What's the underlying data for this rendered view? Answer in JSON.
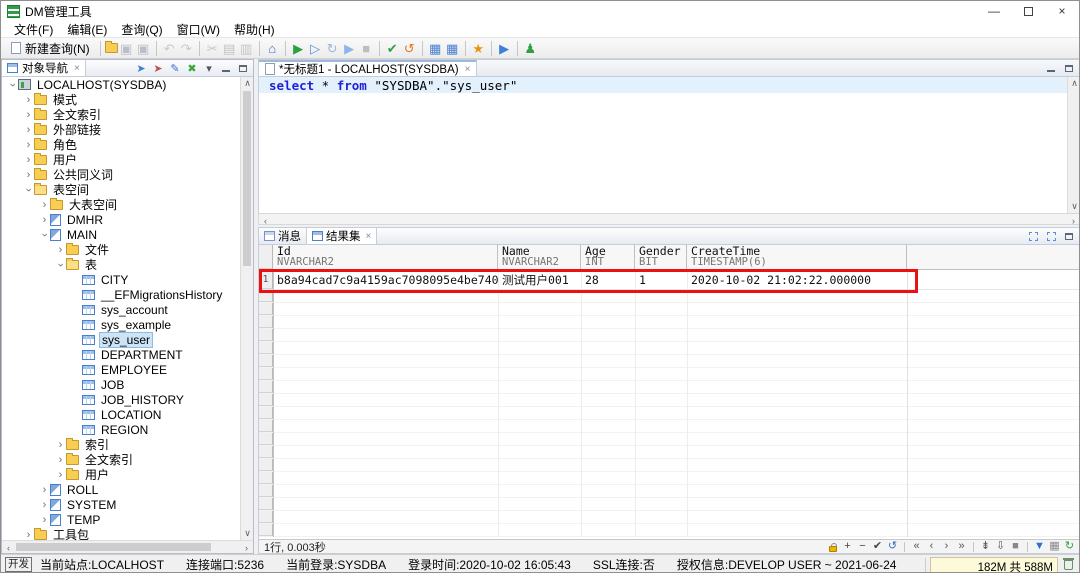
{
  "window": {
    "title": "DM管理工具",
    "controls": {
      "minimize": "—",
      "close": "×"
    }
  },
  "menu": {
    "items": [
      "文件(F)",
      "编辑(E)",
      "查询(Q)",
      "窗口(W)",
      "帮助(H)"
    ]
  },
  "toolbar": {
    "new_query_label": "新建查询(N)",
    "groups": [
      [
        {
          "name": "open-file-icon",
          "art": "folder"
        },
        {
          "name": "save-icon",
          "glyph": "▣",
          "color": "#b8bfc8"
        },
        {
          "name": "save-all-icon",
          "glyph": "▣",
          "color": "#b8bfc8"
        }
      ],
      [
        {
          "name": "undo-icon",
          "glyph": "↶",
          "color": "#c9c9c9"
        },
        {
          "name": "redo-icon",
          "glyph": "↷",
          "color": "#c9c9c9"
        }
      ],
      [
        {
          "name": "cut-icon",
          "glyph": "✂",
          "color": "#c4c4c4"
        },
        {
          "name": "copy-icon",
          "glyph": "▤",
          "color": "#c4c4c4"
        },
        {
          "name": "paste-icon",
          "glyph": "▥",
          "color": "#c4c4c4"
        }
      ],
      [
        {
          "name": "home-icon",
          "glyph": "⌂",
          "color": "#3a6fc4"
        }
      ],
      [
        {
          "name": "run-icon",
          "glyph": "▶",
          "color": "#2ca03c"
        },
        {
          "name": "run-selection-icon",
          "glyph": "▷",
          "color": "#5b8ed8"
        },
        {
          "name": "rerun-icon",
          "glyph": "↻",
          "color": "#9fb6cf"
        },
        {
          "name": "run-script-icon",
          "glyph": "▶",
          "color": "#8fb4e8"
        },
        {
          "name": "stop-icon",
          "glyph": "■",
          "color": "#bdbdbd"
        }
      ],
      [
        {
          "name": "commit-icon",
          "glyph": "✔",
          "color": "#2f9e44"
        },
        {
          "name": "rollback-icon",
          "glyph": "↺",
          "color": "#e07a1f"
        }
      ],
      [
        {
          "name": "explain-plan-icon",
          "glyph": "▦",
          "color": "#4a7fd0"
        },
        {
          "name": "statistics-icon",
          "glyph": "▦",
          "color": "#4a7fd0"
        }
      ],
      [
        {
          "name": "sql-assistant-icon",
          "glyph": "★",
          "color": "#e8950f"
        }
      ],
      [
        {
          "name": "step-run-icon",
          "glyph": "▶",
          "color": "#3f7fd6"
        }
      ],
      [
        {
          "name": "agent-icon",
          "glyph": "♟",
          "color": "#2f9e44"
        }
      ]
    ]
  },
  "navigator": {
    "title": "对象导航",
    "header_icons": [
      {
        "name": "connect-icon",
        "glyph": "➤",
        "color": "#3b7fd0"
      },
      {
        "name": "disconnect-icon",
        "glyph": "➤",
        "color": "#c05050"
      },
      {
        "name": "edit-icon",
        "glyph": "✎",
        "color": "#3a6fc4"
      },
      {
        "name": "close-all-icon",
        "glyph": "✖",
        "color": "#3aa53a"
      },
      {
        "name": "view-menu-icon",
        "glyph": "▾",
        "color": "#556"
      },
      {
        "name": "minimize-icon",
        "art": "min"
      },
      {
        "name": "maximize-icon",
        "art": "max"
      }
    ],
    "tree": [
      {
        "label": "LOCALHOST(SYSDBA)",
        "level": 0,
        "state": "expanded",
        "icon": "server"
      },
      {
        "label": "模式",
        "level": 1,
        "state": "collapsed",
        "icon": "folder"
      },
      {
        "label": "全文索引",
        "level": 1,
        "state": "collapsed",
        "icon": "folder"
      },
      {
        "label": "外部链接",
        "level": 1,
        "state": "collapsed",
        "icon": "folder"
      },
      {
        "label": "角色",
        "level": 1,
        "state": "collapsed",
        "icon": "folder"
      },
      {
        "label": "用户",
        "level": 1,
        "state": "collapsed",
        "icon": "folder"
      },
      {
        "label": "公共同义词",
        "level": 1,
        "state": "collapsed",
        "icon": "folder"
      },
      {
        "label": "表空间",
        "level": 1,
        "state": "expanded",
        "icon": "folder-open"
      },
      {
        "label": "大表空间",
        "level": 2,
        "state": "collapsed",
        "icon": "folder"
      },
      {
        "label": "DMHR",
        "level": 2,
        "state": "collapsed",
        "icon": "ts"
      },
      {
        "label": "MAIN",
        "level": 2,
        "state": "expanded",
        "icon": "ts"
      },
      {
        "label": "文件",
        "level": 3,
        "state": "collapsed",
        "icon": "folder"
      },
      {
        "label": "表",
        "level": 3,
        "state": "expanded",
        "icon": "folder-open"
      },
      {
        "label": "CITY",
        "level": 4,
        "state": "leaf",
        "icon": "table"
      },
      {
        "label": "__EFMigrationsHistory",
        "level": 4,
        "state": "leaf",
        "icon": "table"
      },
      {
        "label": "sys_account",
        "level": 4,
        "state": "leaf",
        "icon": "table"
      },
      {
        "label": "sys_example",
        "level": 4,
        "state": "leaf",
        "icon": "table"
      },
      {
        "label": "sys_user",
        "level": 4,
        "state": "leaf",
        "icon": "table",
        "selected": true
      },
      {
        "label": "DEPARTMENT",
        "level": 4,
        "state": "leaf",
        "icon": "table"
      },
      {
        "label": "EMPLOYEE",
        "level": 4,
        "state": "leaf",
        "icon": "table"
      },
      {
        "label": "JOB",
        "level": 4,
        "state": "leaf",
        "icon": "table"
      },
      {
        "label": "JOB_HISTORY",
        "level": 4,
        "state": "leaf",
        "icon": "table"
      },
      {
        "label": "LOCATION",
        "level": 4,
        "state": "leaf",
        "icon": "table"
      },
      {
        "label": "REGION",
        "level": 4,
        "state": "leaf",
        "icon": "table"
      },
      {
        "label": "索引",
        "level": 3,
        "state": "collapsed",
        "icon": "folder"
      },
      {
        "label": "全文索引",
        "level": 3,
        "state": "collapsed",
        "icon": "folder"
      },
      {
        "label": "用户",
        "level": 3,
        "state": "collapsed",
        "icon": "folder"
      },
      {
        "label": "ROLL",
        "level": 2,
        "state": "collapsed",
        "icon": "ts"
      },
      {
        "label": "SYSTEM",
        "level": 2,
        "state": "collapsed",
        "icon": "ts"
      },
      {
        "label": "TEMP",
        "level": 2,
        "state": "collapsed",
        "icon": "ts"
      },
      {
        "label": "工具包",
        "level": 1,
        "state": "collapsed",
        "icon": "folder"
      }
    ]
  },
  "editor": {
    "tab_title": "*无标题1 - LOCALHOST(SYSDBA)",
    "sql_tokens": [
      {
        "text": "select",
        "kw": true
      },
      {
        "text": " * ",
        "kw": false
      },
      {
        "text": "from",
        "kw": true
      },
      {
        "text": " \"SYSDBA\".\"sys_user\"",
        "kw": false
      }
    ]
  },
  "results": {
    "tabs": [
      "消息",
      "结果集"
    ],
    "active_tab": 1,
    "right_icons": [
      {
        "name": "restore-view-icon",
        "art": "dashedbox"
      },
      {
        "name": "detach-view-icon",
        "art": "dashedbox"
      },
      {
        "name": "maximize-view-icon",
        "art": "max"
      }
    ],
    "grid": {
      "columns": [
        {
          "name": "Id",
          "type": "NVARCHAR2"
        },
        {
          "name": "Name",
          "type": "NVARCHAR2"
        },
        {
          "name": "Age",
          "type": "INT"
        },
        {
          "name": "Gender",
          "type": "BIT"
        },
        {
          "name": "CreateTime",
          "type": "TIMESTAMP(6)"
        }
      ],
      "rows": [
        [
          "b8a94cad7c9a4159ac7098095e4be740",
          "测试用户001",
          "28",
          "1",
          "2020-10-02 21:02:22.000000"
        ]
      ],
      "highlight_row": 0
    },
    "status": "1行, 0.003秒",
    "bottom_icon_groups": [
      [
        {
          "name": "lock-icon",
          "art": "lock"
        },
        {
          "name": "add-row-icon",
          "glyph": "+",
          "color": "#444"
        },
        {
          "name": "delete-row-icon",
          "glyph": "−",
          "color": "#444"
        },
        {
          "name": "commit-edit-icon",
          "glyph": "✔",
          "color": "#444"
        },
        {
          "name": "revert-edit-icon",
          "glyph": "↺",
          "color": "#3b6fc4"
        }
      ],
      [
        {
          "name": "first-page-icon",
          "glyph": "«",
          "color": "#555"
        },
        {
          "name": "prev-page-icon",
          "glyph": "‹",
          "color": "#555"
        },
        {
          "name": "next-page-icon",
          "glyph": "›",
          "color": "#555"
        },
        {
          "name": "last-page-icon",
          "glyph": "»",
          "color": "#555"
        }
      ],
      [
        {
          "name": "fetch-next-icon",
          "glyph": "⇟",
          "color": "#555"
        },
        {
          "name": "fetch-all-icon",
          "glyph": "⇩",
          "color": "#555"
        },
        {
          "name": "stop-fetch-icon",
          "glyph": "■",
          "color": "#888"
        }
      ],
      [
        {
          "name": "filter-icon",
          "glyph": "▼",
          "color": "#2f6fd4"
        },
        {
          "name": "export-grid-icon",
          "glyph": "▦",
          "color": "#8a8a8a"
        },
        {
          "name": "refresh-grid-icon",
          "glyph": "↻",
          "color": "#2f9e44"
        }
      ]
    ]
  },
  "statusbar": {
    "badge": "开发",
    "items": [
      "当前站点:LOCALHOST",
      "连接端口:5236",
      "当前登录:SYSDBA",
      "登录时间:2020-10-02 16:05:43",
      "SSL连接:否",
      "授权信息:DEVELOP USER ~ 2021-06-24"
    ],
    "memory": "182M 共 588M"
  }
}
